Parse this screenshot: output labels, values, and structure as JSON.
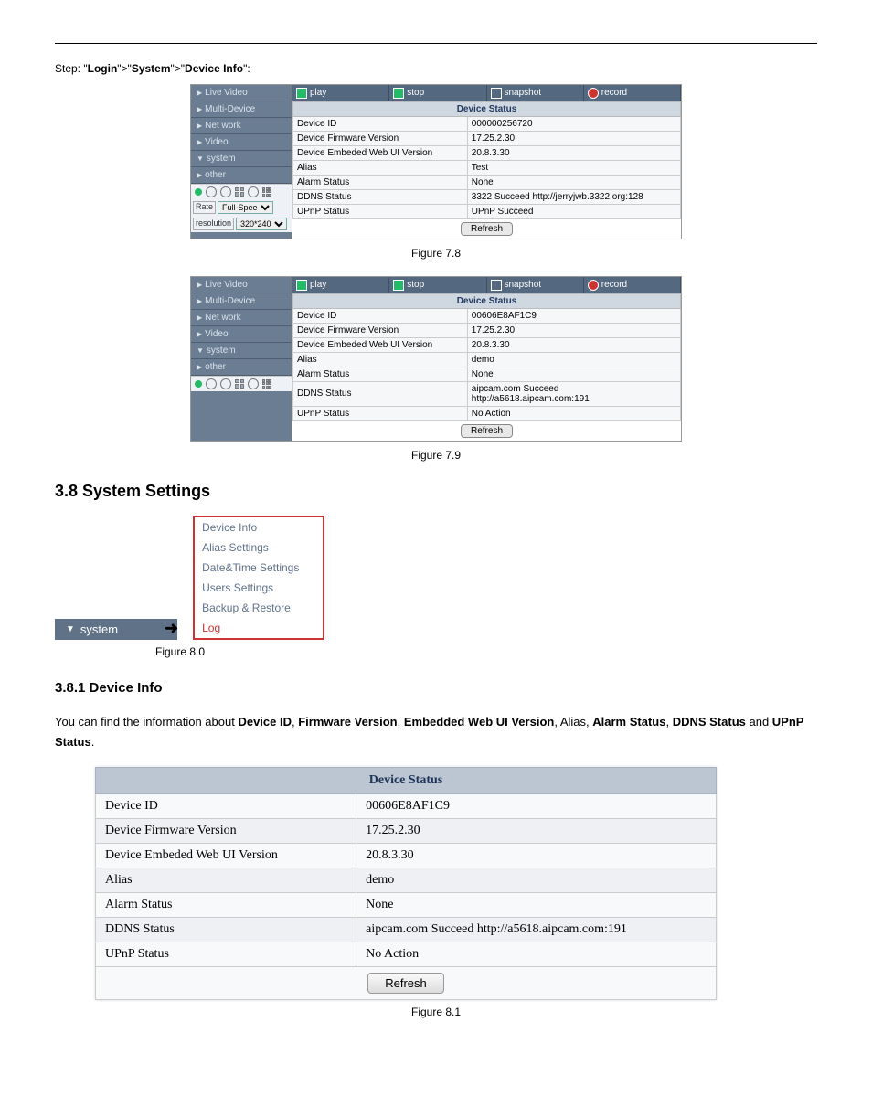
{
  "step_text": {
    "prefix": "Step: \"",
    "a": "Login",
    "s1": "\">\"",
    "b": "System",
    "s2": "\">\"",
    "c": "Device Info",
    "suffix": "\":"
  },
  "nav": {
    "live": "Live Video",
    "multi": "Multi-Device",
    "network": "Net work",
    "video": "Video",
    "system": "system",
    "other": "other",
    "rate_label": "Rate",
    "rate_value": "Full-Spee",
    "resolution_label": "resolution",
    "resolution_value": "320*240"
  },
  "topbar": {
    "play": "play",
    "stop": "stop",
    "snapshot": "snapshot",
    "record": "record"
  },
  "ds_header": "Device Status",
  "panel78": {
    "rows": [
      {
        "k": "Device ID",
        "v": "000000256720"
      },
      {
        "k": "Device Firmware Version",
        "v": "17.25.2.30"
      },
      {
        "k": "Device Embeded Web UI Version",
        "v": "20.8.3.30"
      },
      {
        "k": "Alias",
        "v": "Test"
      },
      {
        "k": "Alarm Status",
        "v": "None"
      },
      {
        "k": "DDNS Status",
        "v": "3322 Succeed  http://jerryjwb.3322.org:128"
      },
      {
        "k": "UPnP Status",
        "v": "UPnP Succeed"
      }
    ],
    "refresh": "Refresh"
  },
  "cap78": "Figure 7.8",
  "panel79": {
    "rows": [
      {
        "k": "Device ID",
        "v": "00606E8AF1C9"
      },
      {
        "k": "Device Firmware Version",
        "v": "17.25.2.30"
      },
      {
        "k": "Device Embeded Web UI Version",
        "v": "20.8.3.30"
      },
      {
        "k": "Alias",
        "v": "demo"
      },
      {
        "k": "Alarm Status",
        "v": "None"
      },
      {
        "k": "DDNS Status",
        "v": "aipcam.com  Succeed  http://a5618.aipcam.com:191"
      },
      {
        "k": "UPnP Status",
        "v": "No Action"
      }
    ],
    "refresh": "Refresh"
  },
  "cap79": "Figure 7.9",
  "sec38": "3.8 System Settings",
  "system_menu": {
    "button": "system",
    "items": [
      "Device Info",
      "Alias Settings",
      "Date&Time Settings",
      "Users Settings",
      "Backup & Restore",
      "Log"
    ]
  },
  "cap80": "Figure 8.0",
  "sec381": "3.8.1 Device Info",
  "para381": {
    "p1": "You can find the information about ",
    "b1": "Device ID",
    "c1": ", ",
    "b2": "Firmware Version",
    "c2": ", ",
    "b3": "Embedded Web UI Version",
    "c3": ", Alias, ",
    "b4": "Alarm Status",
    "c4": ", ",
    "b5": "DDNS Status",
    "c5": " and ",
    "b6": "UPnP Status",
    "c6": "."
  },
  "bigtable": {
    "header": "Device Status",
    "rows": [
      {
        "k": "Device ID",
        "v": "00606E8AF1C9"
      },
      {
        "k": "Device Firmware Version",
        "v": "17.25.2.30"
      },
      {
        "k": "Device Embeded Web UI Version",
        "v": "20.8.3.30"
      },
      {
        "k": "Alias",
        "v": "demo"
      },
      {
        "k": "Alarm Status",
        "v": "None"
      },
      {
        "k": "DDNS Status",
        "v": "aipcam.com  Succeed  http://a5618.aipcam.com:191"
      },
      {
        "k": "UPnP Status",
        "v": "No Action"
      }
    ],
    "refresh": "Refresh"
  },
  "cap81": "Figure 8.1"
}
